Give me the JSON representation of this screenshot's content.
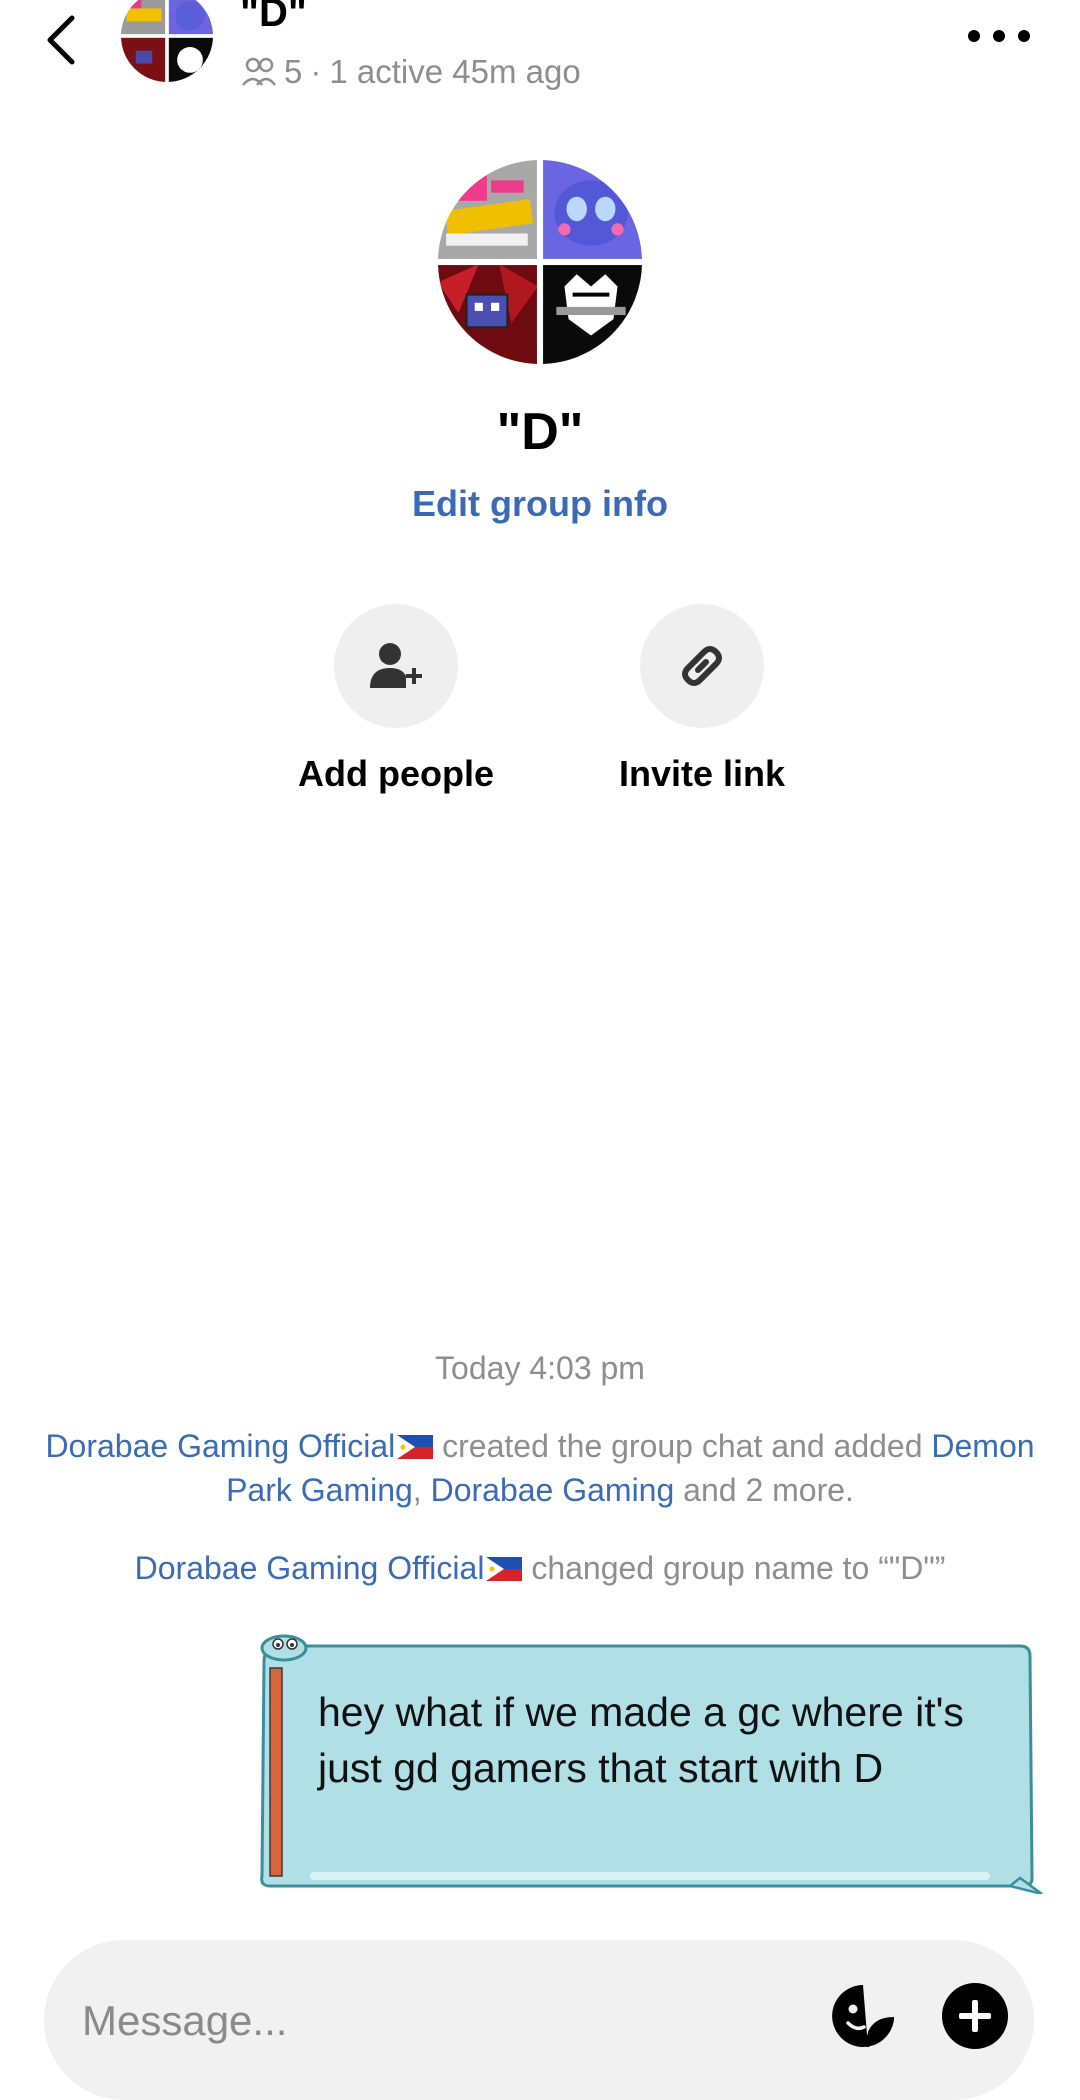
{
  "header": {
    "title": "\"D\"",
    "member_count": "5",
    "separator": "·",
    "activity": "1 active 45m ago",
    "back_icon": "chevron-left-icon",
    "more_icon": "more-horizontal-icon"
  },
  "profile": {
    "group_name": "\"D\"",
    "edit_label": "Edit group info",
    "avatar_quadrants": [
      "yellow-pink-logo",
      "blue-character",
      "red-gd-cube",
      "black-white-mask"
    ]
  },
  "actions": [
    {
      "label": "Add people",
      "icon": "add-person-icon"
    },
    {
      "label": "Invite link",
      "icon": "link-icon"
    }
  ],
  "conversation": {
    "timestamp": "Today 4:03 pm",
    "system1": {
      "actor": "Dorabae Gaming Official",
      "text_a": " created the group chat and added ",
      "user1": "Demon Park Gaming",
      "comma": ", ",
      "user2": "Dorabae Gaming",
      "text_b": " and 2 more."
    },
    "system2": {
      "actor": "Dorabae Gaming Official",
      "text": " changed group name to “\"D\"”"
    },
    "bubble_text": "hey what if we made a gc where it's just gd gamers that start with D"
  },
  "composer": {
    "placeholder": "Message...",
    "sticker_icon": "sticker-face-icon",
    "plus_icon": "plus-circle-icon"
  },
  "colors": {
    "link": "#3c6bb5",
    "muted": "#8e8e8e",
    "bubble_fill": "#b0e0e6",
    "bubble_border": "#3a8f9a"
  }
}
